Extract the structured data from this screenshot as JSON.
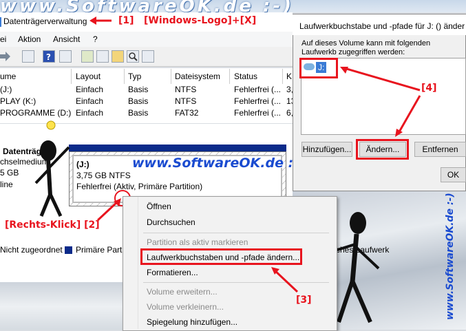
{
  "banner": {
    "text": "www.SoftwareOK.de :-)"
  },
  "window": {
    "title": "Datenträgerverwaltung"
  },
  "annotations": {
    "a1": "[1]",
    "a1_hint": "[Windows-Logo]+[X]",
    "a2": "[Rechts-Klick] [2]",
    "a3": "[3]",
    "a4": "[4]"
  },
  "menu": {
    "file": "ei",
    "action": "Aktion",
    "view": "Ansicht",
    "help": "?"
  },
  "columns": [
    "ume",
    "Layout",
    "Typ",
    "Dateisystem",
    "Status",
    "K"
  ],
  "volumes": [
    {
      "name": "(J:)",
      "layout": "Einfach",
      "type": "Basis",
      "fs": "NTFS",
      "status": "Fehlerfrei (...",
      "cap": "3,"
    },
    {
      "name": "PLAY (K:)",
      "layout": "Einfach",
      "type": "Basis",
      "fs": "NTFS",
      "status": "Fehlerfrei (...",
      "cap": "13"
    },
    {
      "name": "PROGRAMME (D:)",
      "layout": "Einfach",
      "type": "Basis",
      "fs": "FAT32",
      "status": "Fehlerfrei (...",
      "cap": "6,"
    }
  ],
  "disk": {
    "label": "Datenträge",
    "kind": "chselmedium",
    "size": "5 GB",
    "state": "line"
  },
  "partition": {
    "drive": "(J:)",
    "size": "3,75 GB NTFS",
    "status": "Fehlerfrei (Aktiv, Primäre Partition)"
  },
  "watermark": "www.SoftwareOK.de :-)",
  "legend": {
    "unallocated": "Nicht zugeordnet",
    "primary": "Primäre Partit",
    "extra": "ches Laufwerk"
  },
  "context_menu": {
    "open": "Öffnen",
    "explore": "Durchsuchen",
    "mark_active": "Partition als aktiv markieren",
    "change_letter": "Laufwerkbuchstaben und -pfade ändern...",
    "format": "Formatieren...",
    "extend": "Volume erweitern...",
    "shrink": "Volume verkleinern...",
    "mirror": "Spiegelung hinzufügen..."
  },
  "dialog": {
    "title": "Laufwerkbuchstabe und -pfade für J: () änder",
    "description": "Auf dieses Volume kann mit folgenden Laufwerkb zugegriffen werden:",
    "item": "J:",
    "add": "Hinzufügen...",
    "change": "Ändern...",
    "remove": "Entfernen",
    "ok": "OK"
  },
  "vertical_watermark": "www.SoftwareOK.de :-)"
}
